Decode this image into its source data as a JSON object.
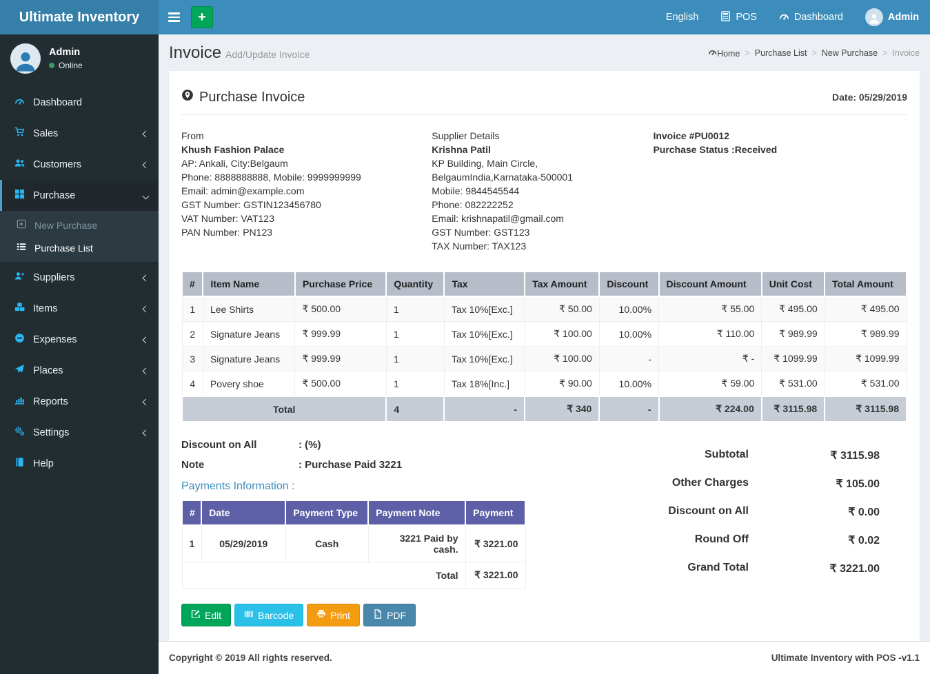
{
  "brand": {
    "title": "Ultimate Inventory"
  },
  "navbar": {
    "plus_label": "+",
    "language": "English",
    "pos_label": "POS",
    "dashboard_label": "Dashboard",
    "user_label": "Admin"
  },
  "colors": {
    "navbar_blue": "#3c8dbc",
    "brand_blue": "#367fa9",
    "sidebar_dark": "#222d32",
    "icon_cyan": "#29b6f2",
    "items_header_gray": "#b6bdc8",
    "payments_header_purple": "#5d5fa7",
    "green": "#00a65a",
    "cyan": "#2bc0e8",
    "orange": "#f39c12",
    "steel_blue": "#4987ab"
  },
  "sidebar": {
    "user": {
      "name": "Admin",
      "status": "Online"
    },
    "items": [
      {
        "label": "Dashboard",
        "icon": "tachometer-icon"
      },
      {
        "label": "Sales",
        "icon": "cart-icon",
        "chevron": "left"
      },
      {
        "label": "Customers",
        "icon": "users-icon",
        "chevron": "left"
      },
      {
        "label": "Purchase",
        "icon": "grid-icon",
        "chevron": "down",
        "active": true,
        "children": [
          {
            "label": "New Purchase",
            "icon": "plus-square-icon",
            "muted": true
          },
          {
            "label": "Purchase List",
            "icon": "list-icon",
            "active": true
          }
        ]
      },
      {
        "label": "Suppliers",
        "icon": "user-plus-icon",
        "chevron": "left"
      },
      {
        "label": "Items",
        "icon": "cubes-icon",
        "chevron": "left"
      },
      {
        "label": "Expenses",
        "icon": "minus-circle-icon",
        "chevron": "left"
      },
      {
        "label": "Places",
        "icon": "paper-plane-icon",
        "chevron": "left"
      },
      {
        "label": "Reports",
        "icon": "bar-chart-icon",
        "chevron": "left"
      },
      {
        "label": "Settings",
        "icon": "gears-icon",
        "chevron": "left"
      },
      {
        "label": "Help",
        "icon": "book-icon"
      }
    ]
  },
  "page": {
    "title": "Invoice",
    "subtitle": "Add/Update Invoice",
    "breadcrumb": [
      "Home",
      "Purchase List",
      "New Purchase",
      "Invoice"
    ]
  },
  "invoice": {
    "card_title": "Purchase Invoice",
    "date_label": "Date: 05/29/2019",
    "from": {
      "heading": "From",
      "name": "Khush Fashion Palace",
      "lines": [
        "AP: Ankali, City:Belgaum",
        "Phone: 8888888888, Mobile: 9999999999",
        "Email: admin@example.com",
        "GST Number: GSTIN123456780",
        "VAT Number: VAT123",
        "PAN Number: PN123"
      ]
    },
    "supplier": {
      "heading": "Supplier Details",
      "name": "Krishna Patil",
      "lines": [
        "KP Building, Main Circle, BelgaumIndia,Karnataka-500001",
        "Mobile: 9844545544",
        "Phone: 082222252",
        "Email: krishnapatil@gmail.com",
        "GST Number: GST123",
        "TAX Number: TAX123"
      ]
    },
    "meta": {
      "invoice_no": "Invoice #PU0012",
      "status": "Purchase Status :Received"
    },
    "items_table": {
      "headers": [
        "#",
        "Item Name",
        "Purchase Price",
        "Quantity",
        "Tax",
        "Tax Amount",
        "Discount",
        "Discount Amount",
        "Unit Cost",
        "Total Amount"
      ],
      "rows": [
        [
          "1",
          "Lee Shirts",
          "₹ 500.00",
          "1",
          "Tax 10%[Exc.]",
          "₹ 50.00",
          "10.00%",
          "₹ 55.00",
          "₹ 495.00",
          "₹ 495.00"
        ],
        [
          "2",
          "Signature Jeans",
          "₹ 999.99",
          "1",
          "Tax 10%[Exc.]",
          "₹ 100.00",
          "10.00%",
          "₹ 110.00",
          "₹ 989.99",
          "₹ 989.99"
        ],
        [
          "3",
          "Signature Jeans",
          "₹ 999.99",
          "1",
          "Tax 10%[Exc.]",
          "₹ 100.00",
          "-",
          "₹ -",
          "₹ 1099.99",
          "₹ 1099.99"
        ],
        [
          "4",
          "Povery shoe",
          "₹ 500.00",
          "1",
          "Tax 18%[Inc.]",
          "₹ 90.00",
          "10.00%",
          "₹ 59.00",
          "₹ 531.00",
          "₹ 531.00"
        ]
      ],
      "total_row": {
        "label": "Total",
        "cells": [
          "4",
          "-",
          "₹ 340",
          "-",
          "₹ 224.00",
          "₹ 3115.98",
          "₹ 3115.98"
        ]
      }
    },
    "discount_on_all_label": "Discount on All",
    "discount_on_all_value": ": (%)",
    "note_label": "Note",
    "note_value": ": Purchase Paid 3221",
    "payments_heading": "Payments Information :",
    "payments_table": {
      "headers": [
        "#",
        "Date",
        "Payment Type",
        "Payment Note",
        "Payment"
      ],
      "rows": [
        [
          "1",
          "05/29/2019",
          "Cash",
          "3221 Paid by cash.",
          "₹ 3221.00"
        ]
      ],
      "total_label": "Total",
      "total_value": "₹ 3221.00"
    },
    "summary": [
      {
        "label": "Subtotal",
        "value": "₹ 3115.98"
      },
      {
        "label": "Other Charges",
        "value": "₹ 105.00"
      },
      {
        "label": "Discount on All",
        "value": "₹ 0.00"
      },
      {
        "label": "Round Off",
        "value": "₹ 0.02"
      },
      {
        "label": "Grand Total",
        "value": "₹ 3221.00"
      }
    ],
    "buttons": [
      {
        "label": "Edit",
        "icon": "edit-icon",
        "bg": "#00a65a",
        "border": "#008d4c"
      },
      {
        "label": "Barcode",
        "icon": "barcode-icon",
        "bg": "#2bc0e8",
        "border": "#1cb2db"
      },
      {
        "label": "Print",
        "icon": "print-icon",
        "bg": "#f39c12",
        "border": "#e08e0b"
      },
      {
        "label": "PDF",
        "icon": "pdf-icon",
        "bg": "#4987ab",
        "border": "#3d7799"
      }
    ]
  },
  "footer": {
    "left": "Copyright © 2019 All rights reserved.",
    "right": "Ultimate Inventory with POS -v1.1"
  }
}
